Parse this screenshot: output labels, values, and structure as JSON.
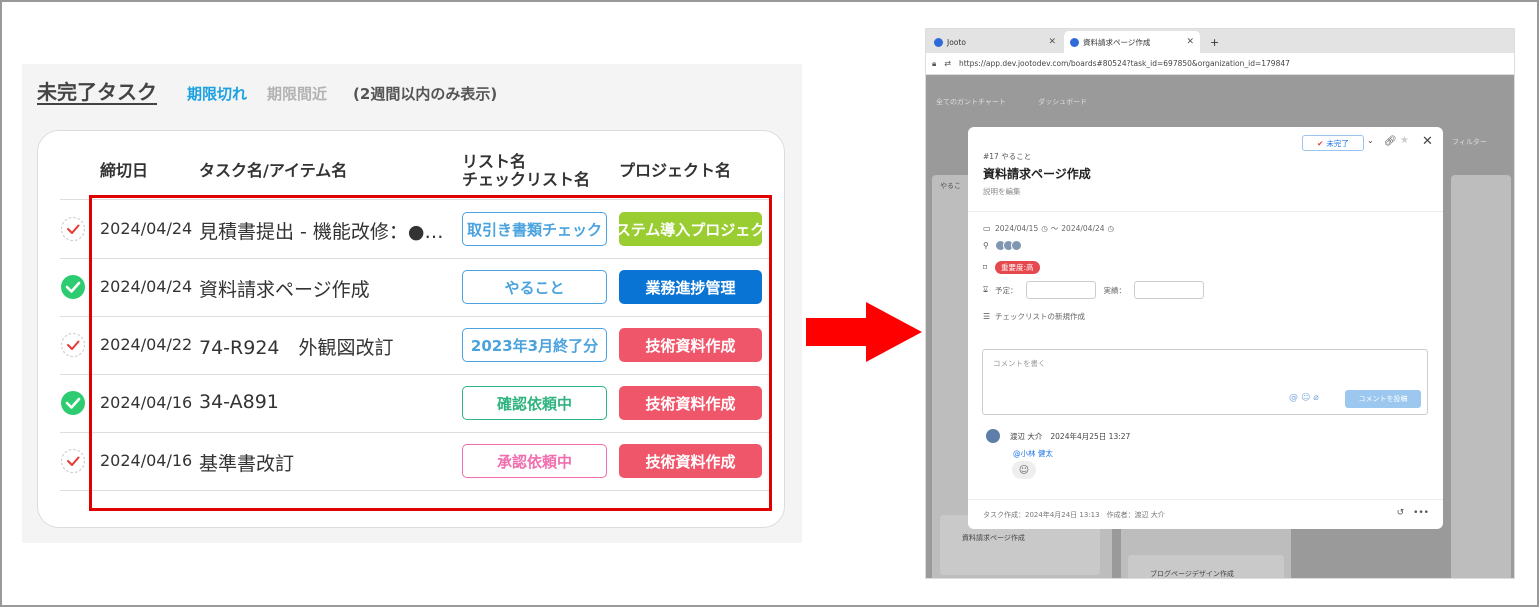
{
  "left": {
    "title": "未完了タスク",
    "tab_overdue": "期限切れ",
    "tab_near": "期限間近",
    "note": "(2週間以内のみ表示)",
    "columns": {
      "deadline": "締切日",
      "task": "タスク名/アイテム名",
      "list_line1": "リスト名",
      "list_line2": "チェックリスト名",
      "project": "プロジェクト名"
    },
    "rows": [
      {
        "done": false,
        "date": "2024/04/24",
        "task": "見積書提出 - 機能改修：●●●",
        "list": "取引き書類チェック",
        "list_color": "#4aa3df",
        "project": "システム導入プロジェクト",
        "project_color": "#9acd32"
      },
      {
        "done": true,
        "date": "2024/04/24",
        "task": "資料請求ページ作成",
        "list": "やること",
        "list_color": "#4aa3df",
        "project": "業務進捗管理",
        "project_color": "#0a74d4"
      },
      {
        "done": false,
        "date": "2024/04/22",
        "task": "74-R924　外観図改訂",
        "list": "2023年3月終了分",
        "list_color": "#4aa3df",
        "project": "技術資料作成",
        "project_color": "#f0566a"
      },
      {
        "done": true,
        "date": "2024/04/16",
        "task": "34-A891",
        "list": "確認依頼中",
        "list_color": "#2fb380",
        "project": "技術資料作成",
        "project_color": "#f0566a"
      },
      {
        "done": false,
        "date": "2024/04/16",
        "task": "基準書改訂",
        "list": "承認依頼中",
        "list_color": "#f06eae",
        "project": "技術資料作成",
        "project_color": "#f0566a"
      }
    ],
    "colors": {
      "check_done": "#2ecc71",
      "check_pending": "#e53935",
      "highlight": "#e00000",
      "arrow": "#ff0000"
    }
  },
  "browser": {
    "tabs": [
      {
        "label": "Jooto"
      },
      {
        "label": "資料請求ページ作成"
      }
    ],
    "new_tab": "+",
    "url": "https://app.dev.jootodev.com/boards#80524?task_id=697850&organization_id=179847",
    "bg_nav_1": "全てのガントチャート",
    "bg_nav_2": "ダッシュボード",
    "bg_filter": "フィルター",
    "bg_col_1": "やるこ",
    "bg_card_text": "資料請求ページ作成",
    "bg_card_text_2": "ブログページデザイン作成",
    "modal": {
      "status": "未完了",
      "crumb": "#17 やること",
      "title": "資料請求ページ作成",
      "desc": "説明を編集",
      "date_start": "2024/04/15",
      "date_sep": "～",
      "date_end": "2024/04/24",
      "importance": "重要度:高",
      "plan_label": "予定：",
      "actual_label": "実績：",
      "checklist": "チェックリストの新規作成",
      "comment_placeholder": "コメントを書く",
      "comment_post": "コメントを投稿",
      "comment_user": "渡辺 大介",
      "comment_time": "2024年4月25日 13:27",
      "comment_mention": "@小林 健太",
      "footer": "タスク作成：2024年4月24日 13:13　作成者：渡辺 大介"
    }
  }
}
